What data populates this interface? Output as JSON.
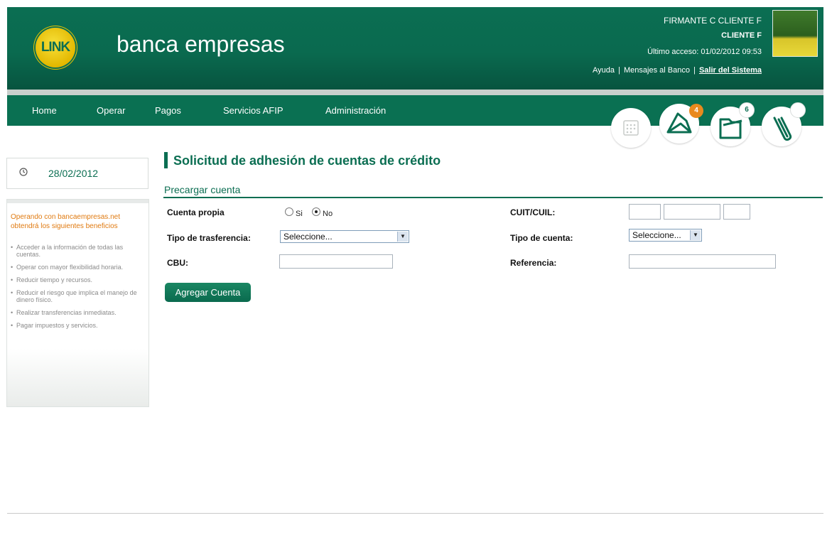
{
  "header": {
    "brand": "banca empresas",
    "logo_text": "LINK",
    "user_name": "FIRMANTE C CLIENTE F",
    "client_name": "CLIENTE F",
    "last_access": "Último acceso: 01/02/2012 09:53",
    "links": {
      "ayuda": "Ayuda",
      "mensajes": "Mensajes al Banco",
      "salir": "Salir del Sistema",
      "separator": "|"
    }
  },
  "nav": {
    "items": [
      "Home",
      "Operar",
      "Pagos",
      "Servicios AFIP",
      "Administración"
    ],
    "icons": [
      {
        "name": "calendar-icon",
        "badge": ""
      },
      {
        "name": "envelope-icon",
        "badge": "4"
      },
      {
        "name": "folder-icon",
        "badge": "6"
      },
      {
        "name": "paperclip-icon",
        "badge": ""
      }
    ]
  },
  "sidebar": {
    "date": "28/02/2012",
    "benefits_title": "Operando con bancaempresas.net obtendrá los siguientes beneficios",
    "benefits": [
      "Acceder a la información de todas las cuentas.",
      "Operar con mayor flexibilidad horaria.",
      "Reducir tiempo y recursos.",
      "Reducir el riesgo que implica el manejo de dinero físico.",
      "Realizar transferencias inmediatas.",
      "Pagar impuestos y servicios."
    ]
  },
  "main": {
    "title": "Solicitud de adhesión de cuentas de crédito",
    "subtitle": "Precargar cuenta",
    "form": {
      "cuenta_propia_label": "Cuenta propia",
      "radio_si": "Si",
      "radio_no": "No",
      "radio_selected": "No",
      "tipo_transferencia_label": "Tipo de trasferencia:",
      "tipo_transferencia_value": "Seleccione...",
      "cbu_label": "CBU:",
      "cbu_value": "",
      "cuit_label": "CUIT/CUIL:",
      "tipo_cuenta_label": "Tipo de cuenta:",
      "tipo_cuenta_value": "Seleccione...",
      "referencia_label": "Referencia:",
      "referencia_value": ""
    },
    "add_button": "Agregar Cuenta"
  },
  "colors": {
    "brand_green": "#0b6e52",
    "accent_orange": "#e07a10"
  }
}
